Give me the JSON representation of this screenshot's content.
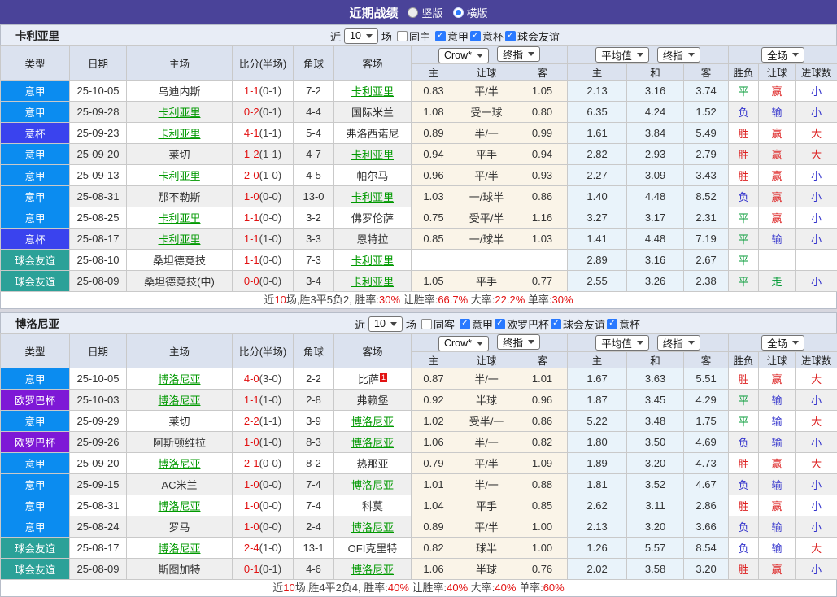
{
  "topbar": {
    "title": "近期战绩",
    "options": [
      {
        "label": "竖版",
        "selected": false
      },
      {
        "label": "横版",
        "selected": true
      }
    ]
  },
  "league_colors": {
    "意甲": "#0b8cf0",
    "意杯": "#3a43ee",
    "球会友谊": "#2ba198",
    "欧罗巴杯": "#7e18d6"
  },
  "status_colors": {
    "r": "#dd2222",
    "g": "#009933",
    "b": "#3333cc"
  },
  "tables": [
    {
      "team": "卡利亚里",
      "filter": {
        "near": "近",
        "count": "10",
        "games": "场",
        "same": {
          "label": "同主",
          "checked": false
        },
        "leagues": [
          {
            "label": "意甲",
            "checked": true
          },
          {
            "label": "意杯",
            "checked": true
          },
          {
            "label": "球会友谊",
            "checked": true
          }
        ]
      },
      "dropdowns": {
        "book": "Crow*",
        "book_final": "终指",
        "avg": "平均值",
        "avg_final": "终指",
        "scope": "全场"
      },
      "columns": {
        "type": "类型",
        "date": "日期",
        "home": "主场",
        "score": "比分(半场)",
        "corner": "角球",
        "away": "客场",
        "odds_home": "主",
        "odds_hcap": "让球",
        "odds_away": "客",
        "avg_home": "主",
        "avg_draw": "和",
        "avg_away": "客",
        "result": "胜负",
        "hcap": "让球",
        "goals": "进球数"
      },
      "rows": [
        {
          "league": "意甲",
          "date": "25-10-05",
          "home": {
            "name": "乌迪内斯",
            "self": false
          },
          "ft": "1-1",
          "ht": "(0-1)",
          "corner": "7-2",
          "away": {
            "name": "卡利亚里",
            "self": true
          },
          "odds": [
            "0.83",
            "平/半",
            "1.05"
          ],
          "avg": [
            "2.13",
            "3.16",
            "3.74"
          ],
          "result": [
            "平",
            "g"
          ],
          "hcap": [
            "赢",
            "r"
          ],
          "goals": [
            "小",
            "b"
          ]
        },
        {
          "league": "意甲",
          "date": "25-09-28",
          "home": {
            "name": "卡利亚里",
            "self": true
          },
          "ft": "0-2",
          "ht": "(0-1)",
          "corner": "4-4",
          "away": {
            "name": "国际米兰",
            "self": false
          },
          "odds": [
            "1.08",
            "受一球",
            "0.80"
          ],
          "avg": [
            "6.35",
            "4.24",
            "1.52"
          ],
          "result": [
            "负",
            "b"
          ],
          "hcap": [
            "输",
            "b"
          ],
          "goals": [
            "小",
            "b"
          ]
        },
        {
          "league": "意杯",
          "date": "25-09-23",
          "home": {
            "name": "卡利亚里",
            "self": true
          },
          "ft": "4-1",
          "ht": "(1-1)",
          "corner": "5-4",
          "away": {
            "name": "弗洛西诺尼",
            "self": false
          },
          "odds": [
            "0.89",
            "半/一",
            "0.99"
          ],
          "avg": [
            "1.61",
            "3.84",
            "5.49"
          ],
          "result": [
            "胜",
            "r"
          ],
          "hcap": [
            "赢",
            "r"
          ],
          "goals": [
            "大",
            "r"
          ]
        },
        {
          "league": "意甲",
          "date": "25-09-20",
          "home": {
            "name": "莱切",
            "self": false
          },
          "ft": "1-2",
          "ht": "(1-1)",
          "corner": "4-7",
          "away": {
            "name": "卡利亚里",
            "self": true
          },
          "odds": [
            "0.94",
            "平手",
            "0.94"
          ],
          "avg": [
            "2.82",
            "2.93",
            "2.79"
          ],
          "result": [
            "胜",
            "r"
          ],
          "hcap": [
            "赢",
            "r"
          ],
          "goals": [
            "大",
            "r"
          ]
        },
        {
          "league": "意甲",
          "date": "25-09-13",
          "home": {
            "name": "卡利亚里",
            "self": true
          },
          "ft": "2-0",
          "ht": "(1-0)",
          "corner": "4-5",
          "away": {
            "name": "帕尔马",
            "self": false
          },
          "odds": [
            "0.96",
            "平/半",
            "0.93"
          ],
          "avg": [
            "2.27",
            "3.09",
            "3.43"
          ],
          "result": [
            "胜",
            "r"
          ],
          "hcap": [
            "赢",
            "r"
          ],
          "goals": [
            "小",
            "b"
          ]
        },
        {
          "league": "意甲",
          "date": "25-08-31",
          "home": {
            "name": "那不勒斯",
            "self": false
          },
          "ft": "1-0",
          "ht": "(0-0)",
          "corner": "13-0",
          "away": {
            "name": "卡利亚里",
            "self": true
          },
          "odds": [
            "1.03",
            "一/球半",
            "0.86"
          ],
          "avg": [
            "1.40",
            "4.48",
            "8.52"
          ],
          "result": [
            "负",
            "b"
          ],
          "hcap": [
            "赢",
            "r"
          ],
          "goals": [
            "小",
            "b"
          ]
        },
        {
          "league": "意甲",
          "date": "25-08-25",
          "home": {
            "name": "卡利亚里",
            "self": true
          },
          "ft": "1-1",
          "ht": "(0-0)",
          "corner": "3-2",
          "away": {
            "name": "佛罗伦萨",
            "self": false
          },
          "odds": [
            "0.75",
            "受平/半",
            "1.16"
          ],
          "avg": [
            "3.27",
            "3.17",
            "2.31"
          ],
          "result": [
            "平",
            "g"
          ],
          "hcap": [
            "赢",
            "r"
          ],
          "goals": [
            "小",
            "b"
          ]
        },
        {
          "league": "意杯",
          "date": "25-08-17",
          "home": {
            "name": "卡利亚里",
            "self": true
          },
          "ft": "1-1",
          "ht": "(1-0)",
          "corner": "3-3",
          "away": {
            "name": "恩特拉",
            "self": false
          },
          "odds": [
            "0.85",
            "一/球半",
            "1.03"
          ],
          "avg": [
            "1.41",
            "4.48",
            "7.19"
          ],
          "result": [
            "平",
            "g"
          ],
          "hcap": [
            "输",
            "b"
          ],
          "goals": [
            "小",
            "b"
          ]
        },
        {
          "league": "球会友谊",
          "date": "25-08-10",
          "home": {
            "name": "桑坦德竞技",
            "self": false
          },
          "ft": "1-1",
          "ht": "(0-0)",
          "corner": "7-3",
          "away": {
            "name": "卡利亚里",
            "self": true
          },
          "odds": [
            "",
            "",
            ""
          ],
          "avg": [
            "2.89",
            "3.16",
            "2.67"
          ],
          "result": [
            "平",
            "g"
          ],
          "hcap": [
            "",
            ""
          ],
          "goals": [
            "",
            ""
          ]
        },
        {
          "league": "球会友谊",
          "date": "25-08-09",
          "home": {
            "name": "桑坦德竞技(中)",
            "self": false
          },
          "ft": "0-0",
          "ht": "(0-0)",
          "corner": "3-4",
          "away": {
            "name": "卡利亚里",
            "self": true
          },
          "odds": [
            "1.05",
            "平手",
            "0.77"
          ],
          "avg": [
            "2.55",
            "3.26",
            "2.38"
          ],
          "result": [
            "平",
            "g"
          ],
          "hcap": [
            "走",
            "g"
          ],
          "goals": [
            "小",
            "b"
          ]
        }
      ],
      "summary": [
        [
          "近",
          0
        ],
        [
          "10",
          1
        ],
        [
          "场,胜3平5负2, 胜率:",
          0
        ],
        [
          "30%",
          1
        ],
        [
          " 让胜率:",
          0
        ],
        [
          "66.7%",
          1
        ],
        [
          " 大率:",
          0
        ],
        [
          "22.2%",
          1
        ],
        [
          " 单率:",
          0
        ],
        [
          "30%",
          1
        ]
      ]
    },
    {
      "team": "博洛尼亚",
      "filter": {
        "near": "近",
        "count": "10",
        "games": "场",
        "same": {
          "label": "同客",
          "checked": false
        },
        "leagues": [
          {
            "label": "意甲",
            "checked": true
          },
          {
            "label": "欧罗巴杯",
            "checked": true
          },
          {
            "label": "球会友谊",
            "checked": true
          },
          {
            "label": "意杯",
            "checked": true
          }
        ]
      },
      "dropdowns": {
        "book": "Crow*",
        "book_final": "终指",
        "avg": "平均值",
        "avg_final": "终指",
        "scope": "全场"
      },
      "columns": {
        "type": "类型",
        "date": "日期",
        "home": "主场",
        "score": "比分(半场)",
        "corner": "角球",
        "away": "客场",
        "odds_home": "主",
        "odds_hcap": "让球",
        "odds_away": "客",
        "avg_home": "主",
        "avg_draw": "和",
        "avg_away": "客",
        "result": "胜负",
        "hcap": "让球",
        "goals": "进球数"
      },
      "rows": [
        {
          "league": "意甲",
          "date": "25-10-05",
          "home": {
            "name": "博洛尼亚",
            "self": true
          },
          "ft": "4-0",
          "ht": "(3-0)",
          "corner": "2-2",
          "away": {
            "name": "比萨",
            "self": false,
            "badge": "1"
          },
          "odds": [
            "0.87",
            "半/一",
            "1.01"
          ],
          "avg": [
            "1.67",
            "3.63",
            "5.51"
          ],
          "result": [
            "胜",
            "r"
          ],
          "hcap": [
            "赢",
            "r"
          ],
          "goals": [
            "大",
            "r"
          ]
        },
        {
          "league": "欧罗巴杯",
          "date": "25-10-03",
          "home": {
            "name": "博洛尼亚",
            "self": true
          },
          "ft": "1-1",
          "ht": "(1-0)",
          "corner": "2-8",
          "away": {
            "name": "弗赖堡",
            "self": false
          },
          "odds": [
            "0.92",
            "半球",
            "0.96"
          ],
          "avg": [
            "1.87",
            "3.45",
            "4.29"
          ],
          "result": [
            "平",
            "g"
          ],
          "hcap": [
            "输",
            "b"
          ],
          "goals": [
            "小",
            "b"
          ]
        },
        {
          "league": "意甲",
          "date": "25-09-29",
          "home": {
            "name": "莱切",
            "self": false
          },
          "ft": "2-2",
          "ht": "(1-1)",
          "corner": "3-9",
          "away": {
            "name": "博洛尼亚",
            "self": true
          },
          "odds": [
            "1.02",
            "受半/一",
            "0.86"
          ],
          "avg": [
            "5.22",
            "3.48",
            "1.75"
          ],
          "result": [
            "平",
            "g"
          ],
          "hcap": [
            "输",
            "b"
          ],
          "goals": [
            "大",
            "r"
          ]
        },
        {
          "league": "欧罗巴杯",
          "date": "25-09-26",
          "home": {
            "name": "阿斯顿维拉",
            "self": false
          },
          "ft": "1-0",
          "ht": "(1-0)",
          "corner": "8-3",
          "away": {
            "name": "博洛尼亚",
            "self": true
          },
          "odds": [
            "1.06",
            "半/一",
            "0.82"
          ],
          "avg": [
            "1.80",
            "3.50",
            "4.69"
          ],
          "result": [
            "负",
            "b"
          ],
          "hcap": [
            "输",
            "b"
          ],
          "goals": [
            "小",
            "b"
          ]
        },
        {
          "league": "意甲",
          "date": "25-09-20",
          "home": {
            "name": "博洛尼亚",
            "self": true
          },
          "ft": "2-1",
          "ht": "(0-0)",
          "corner": "8-2",
          "away": {
            "name": "热那亚",
            "self": false
          },
          "odds": [
            "0.79",
            "平/半",
            "1.09"
          ],
          "avg": [
            "1.89",
            "3.20",
            "4.73"
          ],
          "result": [
            "胜",
            "r"
          ],
          "hcap": [
            "赢",
            "r"
          ],
          "goals": [
            "大",
            "r"
          ]
        },
        {
          "league": "意甲",
          "date": "25-09-15",
          "home": {
            "name": "AC米兰",
            "self": false
          },
          "ft": "1-0",
          "ht": "(0-0)",
          "corner": "7-4",
          "away": {
            "name": "博洛尼亚",
            "self": true
          },
          "odds": [
            "1.01",
            "半/一",
            "0.88"
          ],
          "avg": [
            "1.81",
            "3.52",
            "4.67"
          ],
          "result": [
            "负",
            "b"
          ],
          "hcap": [
            "输",
            "b"
          ],
          "goals": [
            "小",
            "b"
          ]
        },
        {
          "league": "意甲",
          "date": "25-08-31",
          "home": {
            "name": "博洛尼亚",
            "self": true
          },
          "ft": "1-0",
          "ht": "(0-0)",
          "corner": "7-4",
          "away": {
            "name": "科莫",
            "self": false
          },
          "odds": [
            "1.04",
            "平手",
            "0.85"
          ],
          "avg": [
            "2.62",
            "3.11",
            "2.86"
          ],
          "result": [
            "胜",
            "r"
          ],
          "hcap": [
            "赢",
            "r"
          ],
          "goals": [
            "小",
            "b"
          ]
        },
        {
          "league": "意甲",
          "date": "25-08-24",
          "home": {
            "name": "罗马",
            "self": false
          },
          "ft": "1-0",
          "ht": "(0-0)",
          "corner": "2-4",
          "away": {
            "name": "博洛尼亚",
            "self": true
          },
          "odds": [
            "0.89",
            "平/半",
            "1.00"
          ],
          "avg": [
            "2.13",
            "3.20",
            "3.66"
          ],
          "result": [
            "负",
            "b"
          ],
          "hcap": [
            "输",
            "b"
          ],
          "goals": [
            "小",
            "b"
          ]
        },
        {
          "league": "球会友谊",
          "date": "25-08-17",
          "home": {
            "name": "博洛尼亚",
            "self": true
          },
          "ft": "2-4",
          "ht": "(1-0)",
          "corner": "13-1",
          "away": {
            "name": "OFI克里特",
            "self": false
          },
          "odds": [
            "0.82",
            "球半",
            "1.00"
          ],
          "avg": [
            "1.26",
            "5.57",
            "8.54"
          ],
          "result": [
            "负",
            "b"
          ],
          "hcap": [
            "输",
            "b"
          ],
          "goals": [
            "大",
            "r"
          ]
        },
        {
          "league": "球会友谊",
          "date": "25-08-09",
          "home": {
            "name": "斯图加特",
            "self": false
          },
          "ft": "0-1",
          "ht": "(0-1)",
          "corner": "4-6",
          "away": {
            "name": "博洛尼亚",
            "self": true
          },
          "odds": [
            "1.06",
            "半球",
            "0.76"
          ],
          "avg": [
            "2.02",
            "3.58",
            "3.20"
          ],
          "result": [
            "胜",
            "r"
          ],
          "hcap": [
            "赢",
            "r"
          ],
          "goals": [
            "小",
            "b"
          ]
        }
      ],
      "summary": [
        [
          "近",
          0
        ],
        [
          "10",
          1
        ],
        [
          "场,胜4平2负4, 胜率:",
          0
        ],
        [
          "40%",
          1
        ],
        [
          " 让胜率:",
          0
        ],
        [
          "40%",
          1
        ],
        [
          " 大率:",
          0
        ],
        [
          "40%",
          1
        ],
        [
          " 单率:",
          0
        ],
        [
          "60%",
          1
        ]
      ]
    }
  ]
}
